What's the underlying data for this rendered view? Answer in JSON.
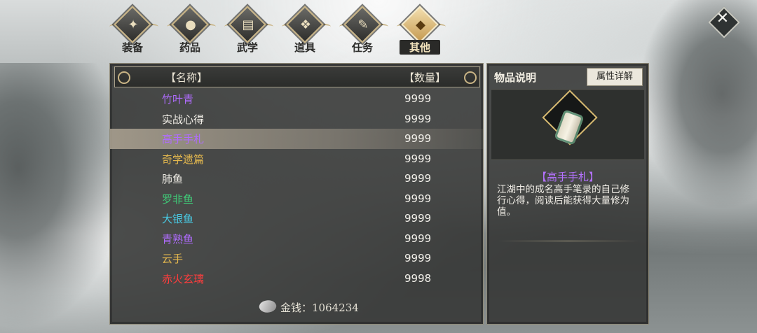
{
  "tabs": [
    {
      "label": "装备",
      "icon": "equipment-icon",
      "glyph": "✦"
    },
    {
      "label": "药品",
      "icon": "medicine-icon",
      "glyph": "●"
    },
    {
      "label": "武学",
      "icon": "martial-arts-book-icon",
      "glyph": "▤"
    },
    {
      "label": "道具",
      "icon": "props-icon",
      "glyph": "❖"
    },
    {
      "label": "任务",
      "icon": "quest-icon",
      "glyph": "✎"
    },
    {
      "label": "其他",
      "icon": "other-icon",
      "glyph": "◆",
      "active": true
    }
  ],
  "close": {
    "glyph": "✕",
    "icon": "close-icon"
  },
  "list": {
    "header_name": "【名称】",
    "header_qty": "【数量】",
    "items": [
      {
        "name": "竹叶青",
        "qty": "9999",
        "color": "#b06cff"
      },
      {
        "name": "实战心得",
        "qty": "9999",
        "color": "#f0ede6"
      },
      {
        "name": "高手手札",
        "qty": "9999",
        "color": "#b06cff",
        "selected": true
      },
      {
        "name": "奇学遗篇",
        "qty": "9999",
        "color": "#e4b84e"
      },
      {
        "name": "肺鱼",
        "qty": "9999",
        "color": "#f0ede6"
      },
      {
        "name": "罗非鱼",
        "qty": "9999",
        "color": "#3fd07a"
      },
      {
        "name": "大银鱼",
        "qty": "9999",
        "color": "#48c7e0"
      },
      {
        "name": "青熟鱼",
        "qty": "9999",
        "color": "#b06cff"
      },
      {
        "name": "云手",
        "qty": "9999",
        "color": "#e4b84e"
      },
      {
        "name": "赤火玄璃",
        "qty": "9998",
        "color": "#ff3d3d"
      }
    ]
  },
  "gold": {
    "label": "金钱：1064234"
  },
  "detail": {
    "title": "物品说明",
    "attr_button": "属性详解",
    "item_name": "【高手手札】",
    "description": "江湖中的成名高手笔录的自己修行心得，阅读后能获得大量修为值。"
  }
}
